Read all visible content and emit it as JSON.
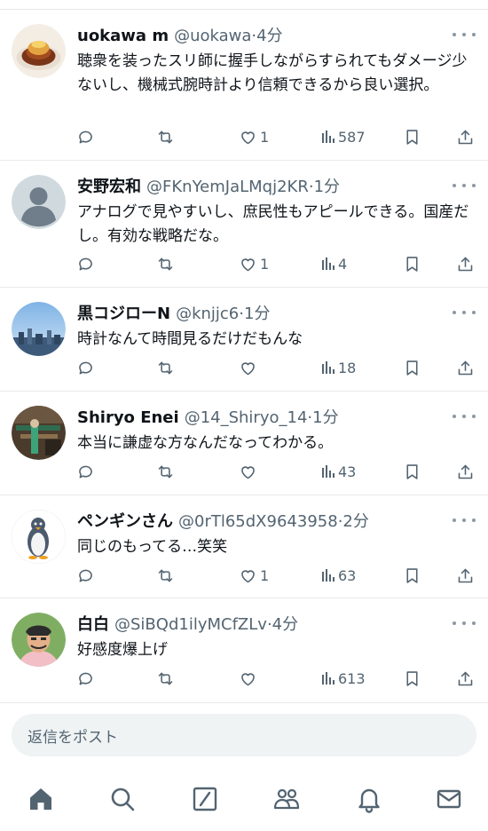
{
  "replies": [
    {
      "name": "uokawa m",
      "handle": "@uokawa",
      "separator": "·",
      "time": "4分",
      "text": "聴衆を装ったスリ師に握手しながらすられてもダメージ少ないし、機械式腕時計より信頼できるから良い選択。",
      "likes": "1",
      "views": "587",
      "avatar": "food-photo"
    },
    {
      "name": "安野宏和",
      "handle": "@FKnYemJaLMqj2KR",
      "separator": "·",
      "time": "1分",
      "text": "アナログで見やすいし、庶民性もアピールできる。国産だし。有効な戦略だな。",
      "likes": "1",
      "views": "4",
      "avatar": "default-silhouette"
    },
    {
      "name": "黒コジローN",
      "handle": "@knjjc6",
      "separator": "·",
      "time": "1分",
      "text": "時計なんて時間見るだけだもんな",
      "likes": "",
      "views": "18",
      "avatar": "city-skyline"
    },
    {
      "name": "Shiryo Enei",
      "handle": "@14_Shiryo_14",
      "separator": "·",
      "time": "1分",
      "text": "本当に謙虚な方なんだなってわかる。",
      "likes": "",
      "views": "43",
      "avatar": "mall-interior"
    },
    {
      "name": "ペンギンさん",
      "handle": "@0rTl65dX9643958",
      "separator": "·",
      "time": "2分",
      "text": "同じのもってる…笑笑",
      "likes": "1",
      "views": "63",
      "avatar": "penguin-illustration"
    },
    {
      "name": "白白",
      "handle": "@SiBQd1ilyMCfZLv",
      "separator": "·",
      "time": "4分",
      "text": "好感度爆上げ",
      "likes": "",
      "views": "613",
      "avatar": "anime-character"
    }
  ],
  "composer": {
    "placeholder": "返信をポスト"
  },
  "tabbar": {
    "items": [
      "home-icon",
      "search-icon",
      "grok-icon",
      "communities-icon",
      "notifications-icon",
      "messages-icon"
    ]
  },
  "colors": {
    "text": "#0f1419",
    "secondary": "#536471",
    "divider": "#e6e9eb",
    "composer_bg": "#eff3f4"
  }
}
